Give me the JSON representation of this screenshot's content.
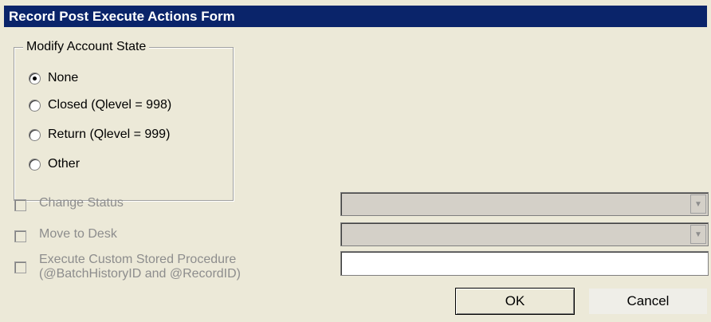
{
  "window": {
    "title": "Record Post Execute Actions Form"
  },
  "account_state": {
    "legend": "Modify Account State",
    "options": [
      {
        "label": "None",
        "checked": true
      },
      {
        "label": "Closed (Qlevel = 998)",
        "checked": false
      },
      {
        "label": "Return (Qlevel = 999)",
        "checked": false
      },
      {
        "label": "Other",
        "checked": false
      }
    ]
  },
  "actions": {
    "change_status": {
      "label": "Change Status",
      "checked": false,
      "enabled": false,
      "combo_value": ""
    },
    "move_to_desk": {
      "label": "Move to Desk",
      "checked": false,
      "enabled": false,
      "combo_value": ""
    },
    "custom_proc": {
      "label_line1": "Execute Custom Stored Procedure",
      "label_line2": "(@BatchHistoryID and @RecordID)",
      "checked": false,
      "enabled": false,
      "value": ""
    }
  },
  "buttons": {
    "ok": "OK",
    "cancel": "Cancel"
  },
  "colors": {
    "titlebar": "#0a246a",
    "dialog_background": "#ece9d8",
    "disabled_text": "#8d8d8d"
  },
  "icons": {
    "combo_arrow": "chevron-down-icon"
  }
}
